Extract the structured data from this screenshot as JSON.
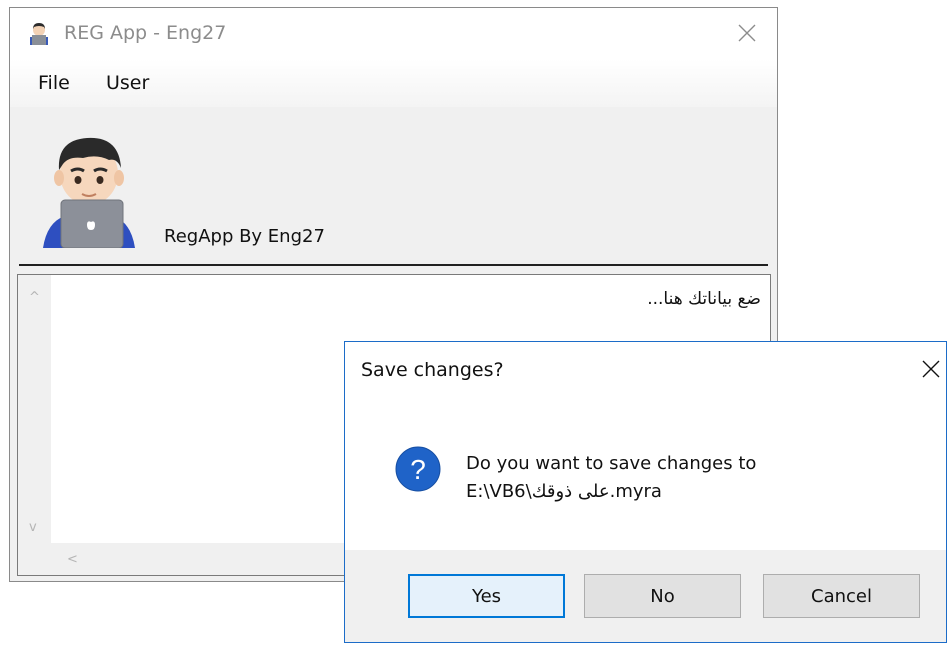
{
  "main_window": {
    "title": "REG App - Eng27",
    "menu": [
      "File",
      "User"
    ],
    "brand_label": "RegApp By Eng27",
    "textbox_content": "ضع بياناتك هنا...",
    "scroll_up": "^",
    "scroll_down": "v",
    "scroll_left": "<"
  },
  "dialog": {
    "title": "Save changes?",
    "message_line1": "Do you want to save changes to",
    "message_line2": "E:\\VB6\\على ذوقك.myra",
    "buttons": {
      "yes": "Yes",
      "no": "No",
      "cancel": "Cancel"
    },
    "accent_color": "#0078d7"
  }
}
